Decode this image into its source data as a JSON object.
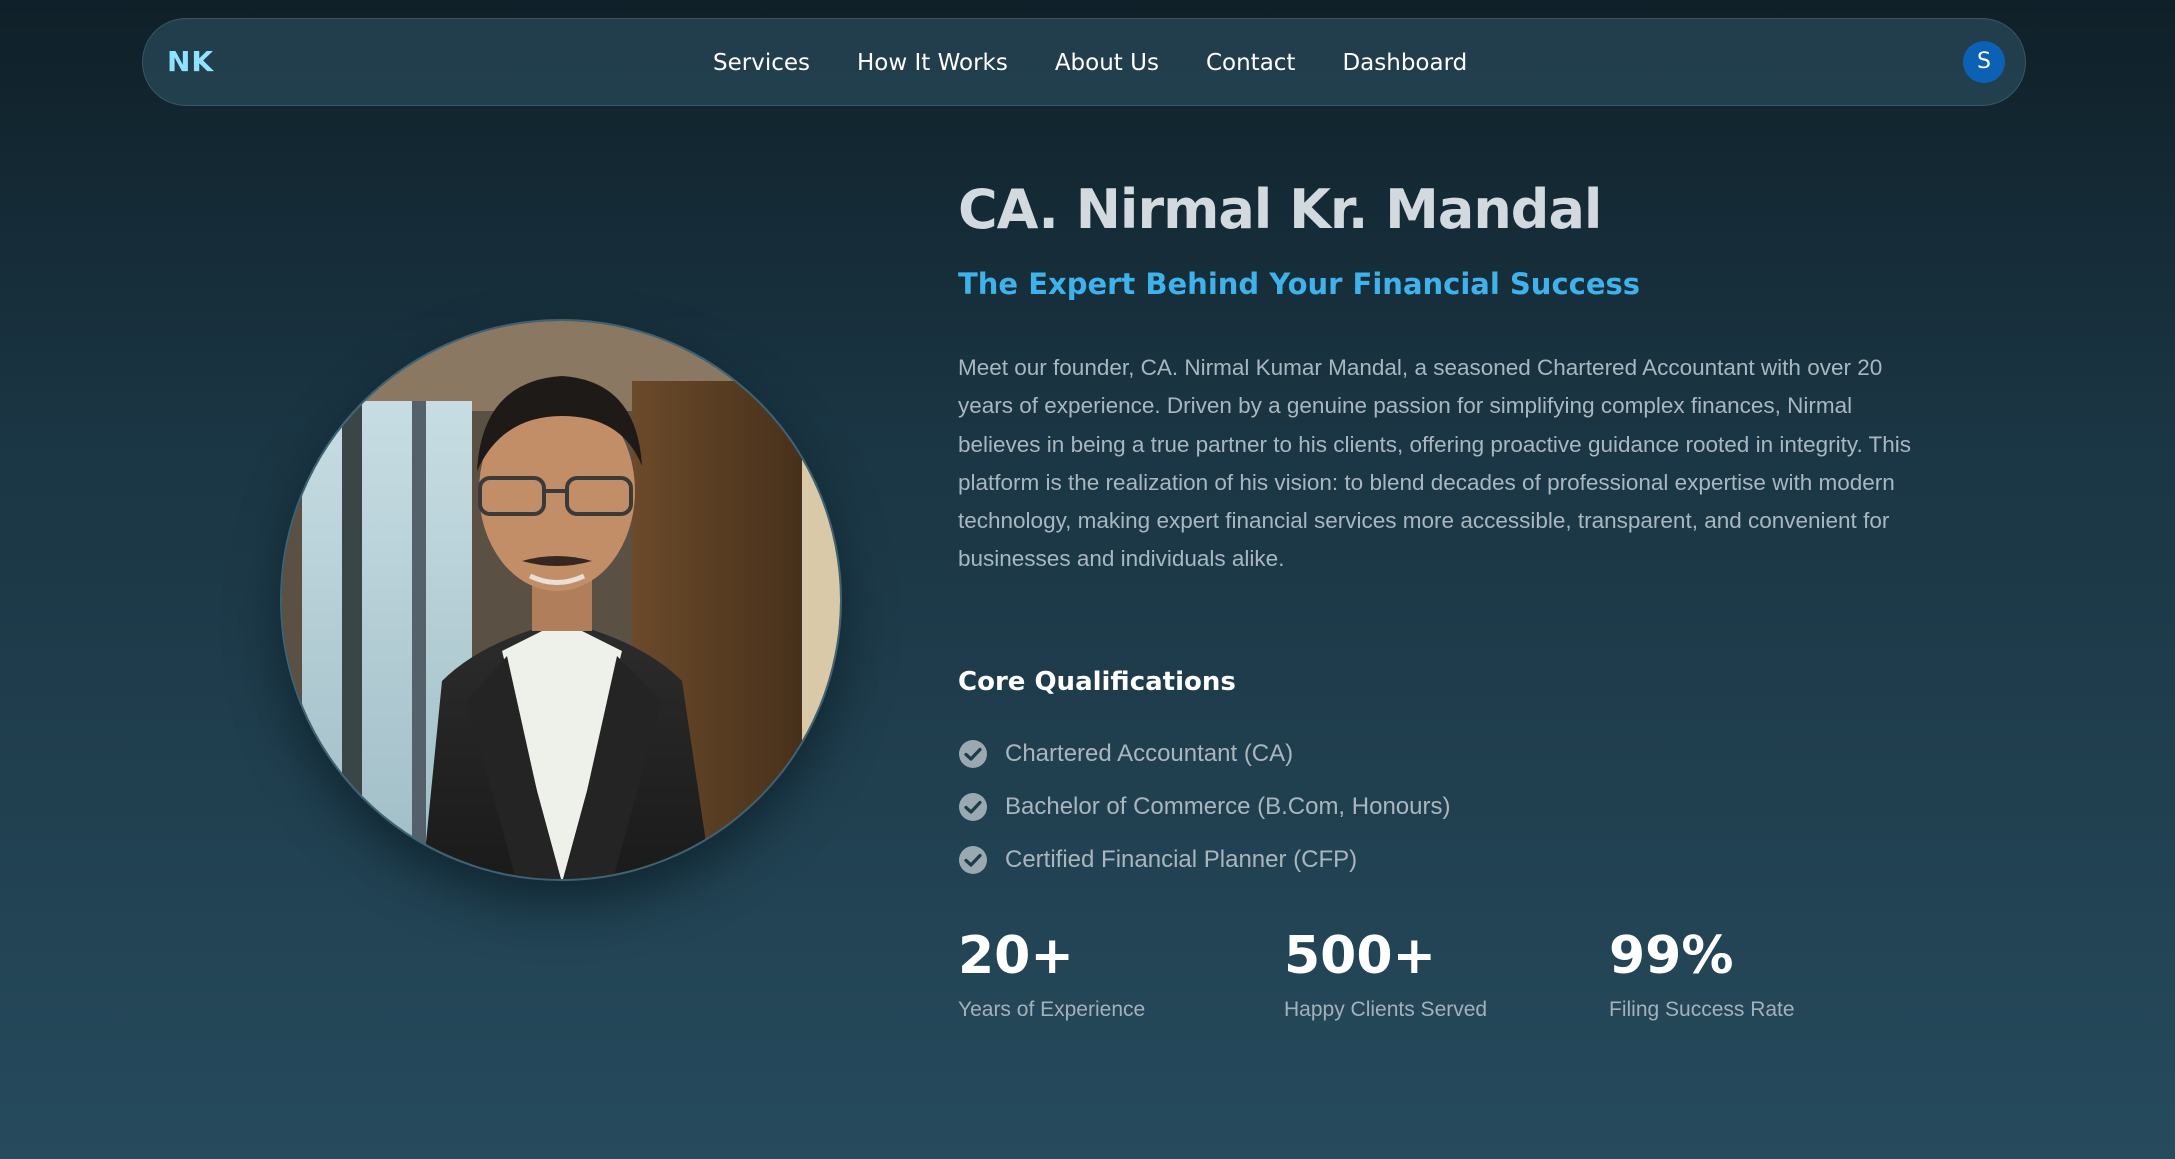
{
  "nav": {
    "logo": "NK",
    "links": [
      "Services",
      "How It Works",
      "About Us",
      "Contact",
      "Dashboard"
    ],
    "avatar_initial": "S"
  },
  "profile": {
    "name": "CA. Nirmal Kr. Mandal",
    "tagline": "The Expert Behind Your Financial Success",
    "bio": "Meet our founder, CA. Nirmal Kumar Mandal, a seasoned Chartered Accountant with over 20 years of experience. Driven by a genuine passion for simplifying complex finances, Nirmal believes in being a true partner to his clients, offering proactive guidance rooted in integrity. This platform is the realization of his vision: to blend decades of professional expertise with modern technology, making expert financial services more accessible, transparent, and convenient for businesses and individuals alike.",
    "qualifications_heading": "Core Qualifications",
    "qualifications": [
      "Chartered Accountant (CA)",
      "Bachelor of Commerce (B.Com, Honours)",
      "Certified Financial Planner (CFP)"
    ]
  },
  "stats": [
    {
      "value": "20+",
      "label": "Years of Experience"
    },
    {
      "value": "500+",
      "label": "Happy Clients Served"
    },
    {
      "value": "99%",
      "label": "Filing Success Rate"
    }
  ],
  "colors": {
    "accent": "#3fb2ec",
    "logo": "#8fe3ff",
    "avatar": "#0d61b5",
    "check_icon": "#9aa8b1"
  }
}
